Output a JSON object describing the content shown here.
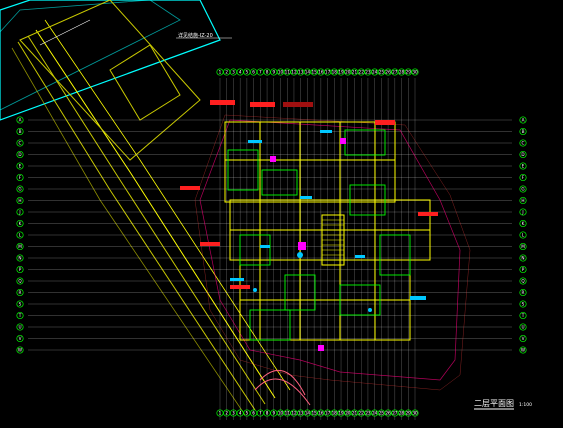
{
  "drawing": {
    "title": "二层平面图",
    "scale": "1:100",
    "note_label": "详见结施-IZ-20"
  },
  "grid_top_labels": [
    "1",
    "2",
    "3",
    "4",
    "5",
    "6",
    "7",
    "8",
    "9",
    "10",
    "11",
    "12",
    "13",
    "14",
    "15",
    "16",
    "17",
    "18",
    "19",
    "20",
    "21",
    "22",
    "23",
    "24",
    "25",
    "26",
    "27",
    "28",
    "29",
    "30"
  ],
  "grid_left_labels": [
    "A",
    "B",
    "C",
    "D",
    "E",
    "F",
    "G",
    "H",
    "J",
    "K",
    "L",
    "M",
    "N",
    "P",
    "Q",
    "R",
    "S",
    "T",
    "U",
    "V",
    "W"
  ],
  "colors": {
    "background": "#000000",
    "frame": "#00ffff",
    "axis": "#ffffff",
    "wall": "#ffff00",
    "green": "#00ff00",
    "magenta": "#ff00ff",
    "red": "#ff0000",
    "cyan": "#00c8ff",
    "olive": "#c8c800",
    "pink": "#ff6080"
  }
}
